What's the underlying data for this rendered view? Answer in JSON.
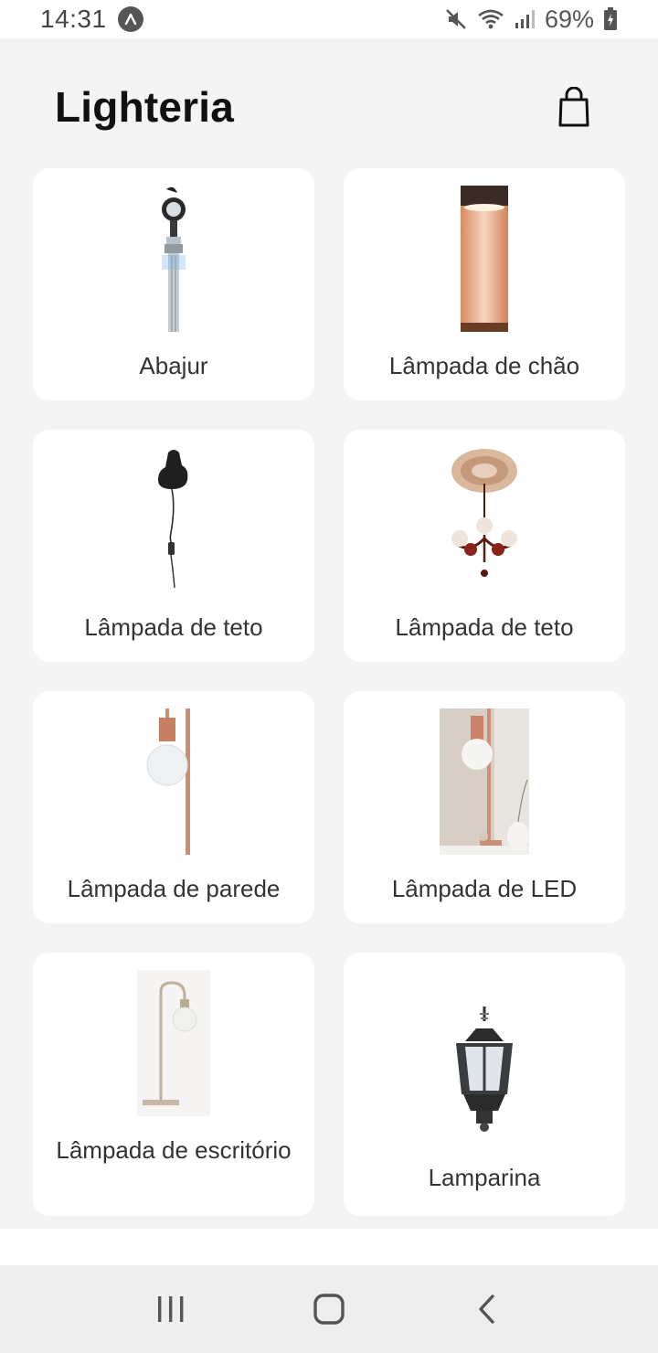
{
  "status_bar": {
    "time": "14:31",
    "battery": "69%",
    "icons": [
      "app-notification-icon",
      "mute-icon",
      "wifi-icon",
      "signal-icon",
      "battery-icon"
    ]
  },
  "header": {
    "title": "Lighteria",
    "cart_icon": "shopping-bag-icon"
  },
  "products": [
    {
      "label": "Abajur",
      "icon": "street-lamp-image"
    },
    {
      "label": "Lâmpada de chão",
      "icon": "floor-lamp-image"
    },
    {
      "label": "Lâmpada de teto",
      "icon": "pendant-lamp-image"
    },
    {
      "label": "Lâmpada de teto",
      "icon": "chandelier-image"
    },
    {
      "label": "Lâmpada de parede",
      "icon": "bulb-rod-lamp-image"
    },
    {
      "label": "Lâmpada de LED",
      "icon": "led-lamp-photo"
    },
    {
      "label": "Lâmpada de escritório",
      "icon": "arc-desk-lamp-image"
    },
    {
      "label": "Lamparina",
      "icon": "lantern-image"
    }
  ],
  "nav_bar": {
    "icons": [
      "recent-apps-icon",
      "home-icon",
      "back-icon"
    ]
  },
  "colors": {
    "background": "#f4f4f4",
    "card": "#ffffff",
    "title": "#111111",
    "nav_bar": "#eeeeee"
  }
}
